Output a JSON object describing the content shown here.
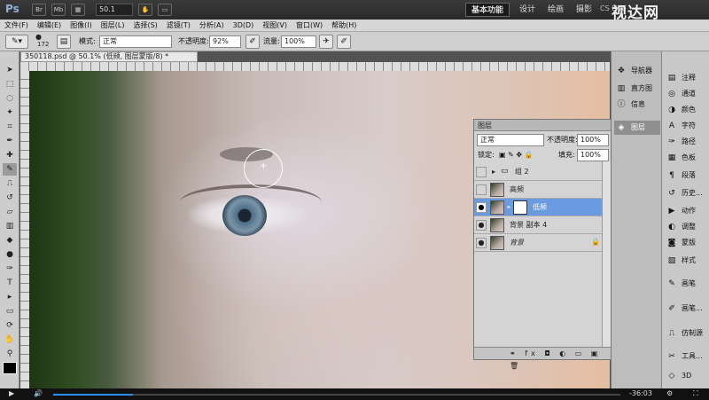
{
  "appbar": {
    "logo": "Ps",
    "mb_label": "Mb",
    "zoom": "50.1",
    "workspaces": [
      "基本功能",
      "设计",
      "绘画",
      "摄影"
    ],
    "active_workspace": "基本功能",
    "cslive": "CS Live"
  },
  "watermark": "视达网",
  "menu": [
    "文件(F)",
    "编辑(E)",
    "图像(I)",
    "图层(L)",
    "选择(S)",
    "滤镜(T)",
    "分析(A)",
    "3D(D)",
    "视图(V)",
    "窗口(W)",
    "帮助(H)"
  ],
  "options": {
    "brush_size": "172",
    "mode_label": "模式:",
    "mode_value": "正常",
    "opacity_label": "不透明度:",
    "opacity_value": "92%",
    "flow_label": "流量:",
    "flow_value": "100%"
  },
  "document": {
    "tab_title": "350118.psd @ 50.1% (低频, 图层蒙版/8) *"
  },
  "layers_panel": {
    "title": "图层",
    "blend_mode": "正常",
    "opacity_label": "不透明度:",
    "opacity_value": "100%",
    "lock_label": "锁定:",
    "fill_label": "填充:",
    "fill_value": "100%",
    "layers": [
      {
        "name": "组 2",
        "visible": false,
        "type": "group"
      },
      {
        "name": "高频",
        "visible": false,
        "type": "layer"
      },
      {
        "name": "低频",
        "visible": true,
        "type": "masked",
        "selected": true
      },
      {
        "name": "背景 副本 4",
        "visible": true,
        "type": "layer"
      },
      {
        "name": "背景",
        "visible": true,
        "type": "background",
        "locked": true
      }
    ],
    "footer": "⚭ fx ◘ ◐ ▭ ▣ 🗑"
  },
  "dock1": [
    {
      "label": "导航器",
      "icon": "navigator-icon"
    },
    {
      "label": "直方图",
      "icon": "histogram-icon"
    },
    {
      "label": "信息",
      "icon": "info-icon"
    },
    {
      "label": "图层",
      "icon": "layers-icon",
      "active": true
    }
  ],
  "dock2": [
    {
      "label": "注释",
      "icon": "note-icon"
    },
    {
      "label": "通道",
      "icon": "channels-icon"
    },
    {
      "label": "颜色",
      "icon": "color-icon"
    },
    {
      "label": "字符",
      "icon": "character-icon"
    },
    {
      "label": "路径",
      "icon": "paths-icon"
    },
    {
      "label": "色板",
      "icon": "swatches-icon"
    },
    {
      "label": "段落",
      "icon": "paragraph-icon"
    },
    {
      "label": "历史...",
      "icon": "history-icon"
    },
    {
      "label": "动作",
      "icon": "actions-icon"
    },
    {
      "label": "调整",
      "icon": "adjustments-icon"
    },
    {
      "label": "蒙版",
      "icon": "masks-icon"
    },
    {
      "label": "样式",
      "icon": "styles-icon"
    },
    {
      "label": "画笔",
      "icon": "brushes-icon"
    },
    {
      "label": "画笔...",
      "icon": "brush-presets-icon"
    },
    {
      "label": "仿制源",
      "icon": "clone-source-icon"
    },
    {
      "label": "工具...",
      "icon": "tool-presets-icon"
    },
    {
      "label": "3D",
      "icon": "3d-icon"
    }
  ],
  "player": {
    "time_remaining": "-36:03",
    "progress": 0.14
  }
}
